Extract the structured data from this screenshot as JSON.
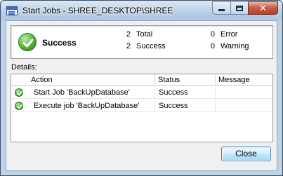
{
  "window": {
    "title": "Start Jobs - SHREE_DESKTOP\\SHREE",
    "icon": "app-window-icon",
    "caption_buttons": [
      "minimize",
      "maximize",
      "close"
    ]
  },
  "summary": {
    "status": "Success",
    "icon": "success-check-icon",
    "total_count": "2",
    "total_label": "Total",
    "success_count": "2",
    "success_label": "Success",
    "error_count": "0",
    "error_label": "Error",
    "warning_count": "0",
    "warning_label": "Warning"
  },
  "details": {
    "label": "Details:",
    "columns": [
      "Action",
      "Status",
      "Message"
    ],
    "rows": [
      {
        "action": "Start Job 'BackUpDatabase'",
        "status": "Success",
        "message": ""
      },
      {
        "action": "Execute job 'BackUpDatabase'",
        "status": "Success",
        "message": ""
      }
    ]
  },
  "buttons": {
    "close_label": "Close"
  },
  "colors": {
    "success_green": "#4fb23a",
    "accent_blue": "#3c7fb1"
  }
}
